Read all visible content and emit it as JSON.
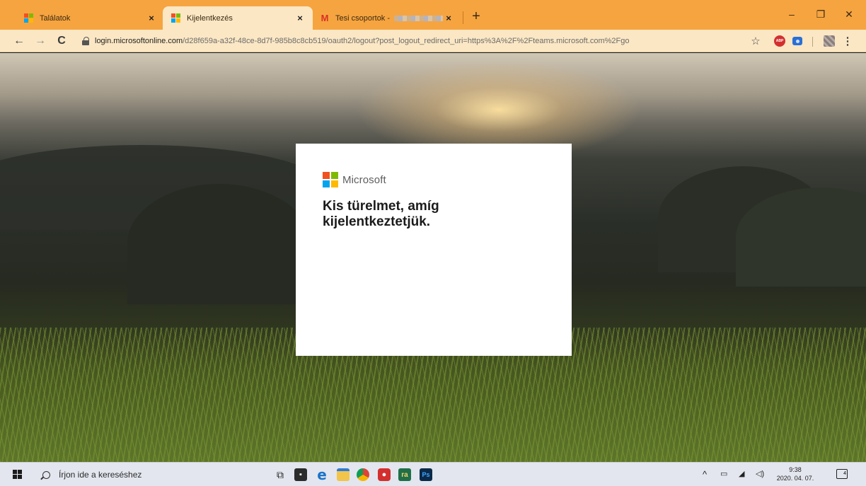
{
  "browser": {
    "tabs": [
      {
        "title": "Találatok",
        "icon": "microsoft-favicon",
        "active": false,
        "close_label": "×"
      },
      {
        "title": "Kijelentkezés",
        "icon": "microsoft-favicon",
        "active": true,
        "close_label": "×"
      },
      {
        "title": "Tesi csoportok - ",
        "icon": "gmail-favicon",
        "active": false,
        "close_label": "×"
      }
    ],
    "new_tab_label": "+",
    "window_controls": {
      "minimize": "–",
      "restore": "❐",
      "close": "✕"
    },
    "toolbar": {
      "back": "←",
      "forward": "→",
      "reload": "C",
      "url_host": "login.microsoftonline.com",
      "url_path": "/d28f659a-a32f-48ce-8d7f-985b8c8cb519/oauth2/logout?post_logout_redirect_uri=https%3A%2F%2Fteams.microsoft.com%2Fgo",
      "star": "☆",
      "menu": "⋮"
    }
  },
  "card": {
    "brand": "Microsoft",
    "message": "Kis türelmet, amíg kijelentkeztetjük.",
    "logo_colors": [
      "#f25022",
      "#7fba00",
      "#00a4ef",
      "#ffb900"
    ]
  },
  "taskbar": {
    "search_placeholder": "Írjon ide a kereséshez",
    "apps": [
      {
        "name": "task-view",
        "glyph": "⧉"
      },
      {
        "name": "app-store",
        "glyph": "▪"
      },
      {
        "name": "edge",
        "glyph": "e"
      },
      {
        "name": "file-explorer",
        "glyph": "▬"
      },
      {
        "name": "chrome",
        "glyph": "●"
      },
      {
        "name": "app-red",
        "glyph": "●"
      },
      {
        "name": "app-ra",
        "glyph": "ra"
      },
      {
        "name": "photoshop",
        "glyph": "Ps"
      }
    ],
    "tray": {
      "chevron": "^",
      "time": "9:38",
      "date": "2020. 04. 07.",
      "notification_count": "4"
    }
  }
}
